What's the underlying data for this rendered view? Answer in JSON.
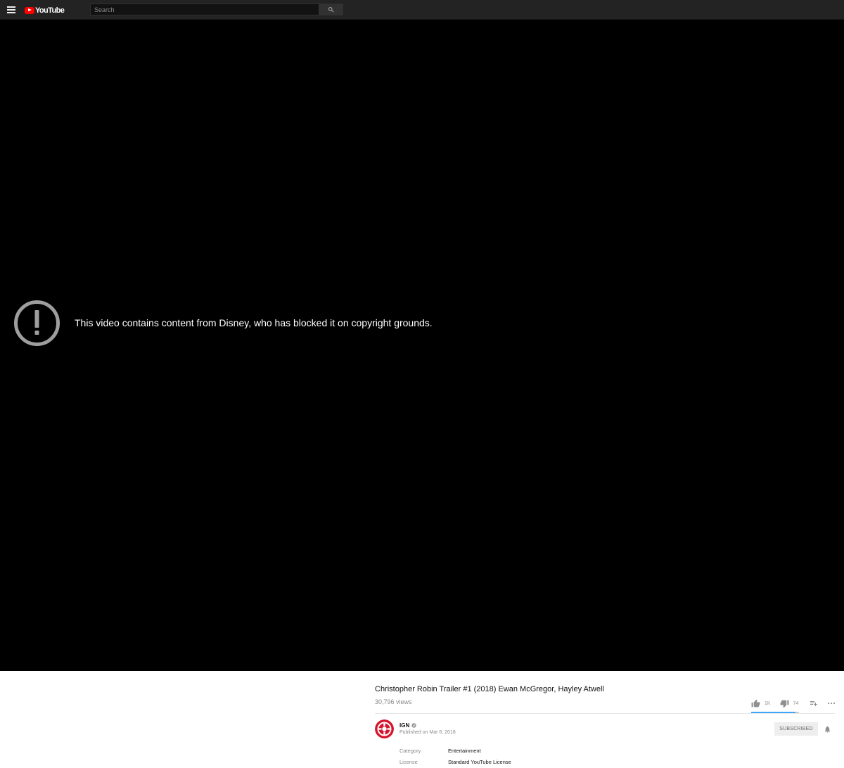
{
  "masthead": {
    "logo_text": "YouTube",
    "search_placeholder": "Search"
  },
  "player": {
    "error_message": "This video contains content from Disney, who has blocked it on copyright grounds."
  },
  "video": {
    "title": "Christopher Robin Trailer #1 (2018) Ewan McGregor, Hayley Atwell",
    "views": "30,796 views",
    "likes": "1K",
    "dislikes": "74",
    "like_ratio": 0.93
  },
  "channel": {
    "name": "IGN",
    "published": "Published on Mar 6, 2018",
    "subscribe_label": "SUBSCRIBED"
  },
  "metadata": [
    {
      "label": "Category",
      "value": "Entertainment"
    },
    {
      "label": "License",
      "value": "Standard YouTube License"
    }
  ],
  "colors": {
    "brand_red": "#ff0000",
    "ign_red": "#d7142b",
    "sentiment_blue": "#3ea6ff"
  }
}
